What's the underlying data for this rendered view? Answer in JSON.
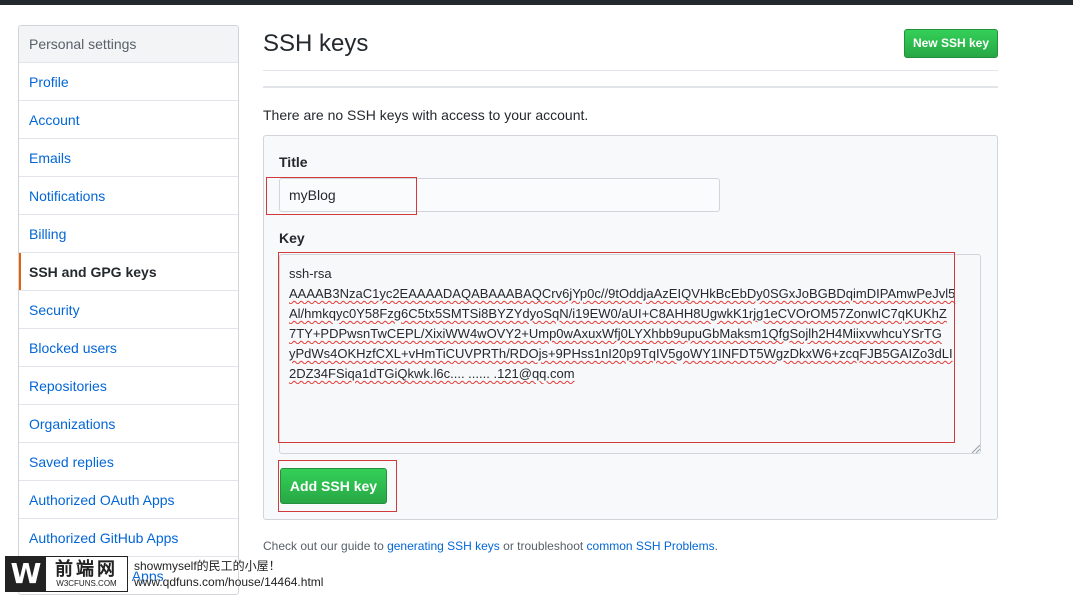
{
  "sidebar": {
    "header": "Personal settings",
    "items": [
      {
        "label": "Profile",
        "selected": false
      },
      {
        "label": "Account",
        "selected": false
      },
      {
        "label": "Emails",
        "selected": false
      },
      {
        "label": "Notifications",
        "selected": false
      },
      {
        "label": "Billing",
        "selected": false
      },
      {
        "label": "SSH and GPG keys",
        "selected": true
      },
      {
        "label": "Security",
        "selected": false
      },
      {
        "label": "Blocked users",
        "selected": false
      },
      {
        "label": "Repositories",
        "selected": false
      },
      {
        "label": "Organizations",
        "selected": false
      },
      {
        "label": "Saved replies",
        "selected": false
      },
      {
        "label": "Authorized OAuth Apps",
        "selected": false
      },
      {
        "label": "Authorized GitHub Apps",
        "selected": false
      },
      {
        "label": "Installed GitHub Apps",
        "selected": false
      }
    ]
  },
  "header": {
    "title": "SSH keys",
    "new_key_button": "New SSH key"
  },
  "notice": "There are no SSH keys with access to your account.",
  "form": {
    "title_label": "Title",
    "title_value": "myBlog",
    "key_label": "Key",
    "key_lines": [
      "ssh-rsa",
      "AAAAB3NzaC1yc2EAAAADAQABAAABAQCrv6jYp0c//9tOddjaAzEIQVHkBcEbDy0SGxJoBGBDqimDIPAmwPeJvl5",
      "Al/hmkqyc0Y58Fzg6C5tx5SMTSi8BYZYdyoSqN/i19EW0/aUI+C8AHH8UgwkK1rjg1eCVOrOM57ZonwIC7qKUKhZ",
      "7TY+PDPwsnTwCEPL/XixiWW4wOVY2+Ump0wAxuxWfj0LYXhbb9upuGbMaksm1QfgSojlh2H4MiixvwhcuYSrTG",
      "yPdWs4OKHzfCXL+vHmTiCUVPRTh/RDOjs+9PHss1nI20p9TqIV5goWY1INFDT5WgzDkxW6+zcqFJB5GAIZo3dLI",
      "2DZ34FSiqa1dTGiQkwk.l6c.... ...... .121@qq.com"
    ],
    "add_button": "Add SSH key"
  },
  "guide": {
    "prefix": "Check out our guide to ",
    "link1": "generating SSH keys",
    "middle": " or troubleshoot ",
    "link2": "common SSH Problems",
    "suffix": "."
  },
  "watermark": {
    "logo_letter": "W",
    "logo_cn": "前端网",
    "logo_sub": "W3CFUNS.COM",
    "line1": "showmyself的民工的小屋！",
    "line2": "www.qdfuns.com/house/14464.html"
  },
  "colors": {
    "link": "#0366d6",
    "green_button": "#28a745",
    "selected_accent": "#e36209",
    "annotation_red": "#d13a3a"
  }
}
